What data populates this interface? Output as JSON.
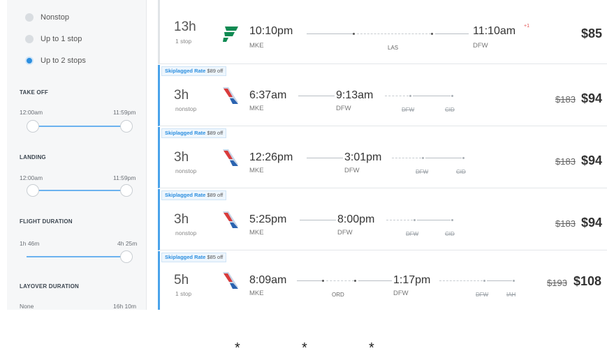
{
  "sidebar": {
    "stops": [
      {
        "label": "Nonstop",
        "selected": false
      },
      {
        "label": "Up to 1 stop",
        "selected": false
      },
      {
        "label": "Up to 2 stops",
        "selected": true
      }
    ],
    "take_off": {
      "title": "TAKE OFF",
      "min": "12:00am",
      "max": "11:59pm"
    },
    "landing": {
      "title": "LANDING",
      "min": "12:00am",
      "max": "11:59pm"
    },
    "flight_duration": {
      "title": "FLIGHT DURATION",
      "min": "1h 46m",
      "max": "4h 25m"
    },
    "layover_duration": {
      "title": "LAYOVER DURATION",
      "min": "None",
      "max": "16h 10m"
    }
  },
  "flights": [
    {
      "duration": "13h",
      "stops": "1 stop",
      "airline": "frontier",
      "depart_time": "10:10pm",
      "depart_airport": "MKE",
      "arrive_time": "11:10am",
      "arrive_plus": "+1",
      "arrive_airport": "DFW",
      "layovers": [
        "LAS"
      ],
      "hidden_layovers": [],
      "old_price": "",
      "price": "$85",
      "badge": null
    },
    {
      "duration": "3h",
      "stops": "nonstop",
      "airline": "american",
      "depart_time": "6:37am",
      "depart_airport": "MKE",
      "arrive_time": "9:13am",
      "arrive_airport": "DFW",
      "layovers": [],
      "hidden_layovers": [
        "DFW",
        "CID"
      ],
      "old_price": "$183",
      "price": "$94",
      "badge": {
        "name": "Skiplagged Rate",
        "off": "$89 off"
      }
    },
    {
      "duration": "3h",
      "stops": "nonstop",
      "airline": "american",
      "depart_time": "12:26pm",
      "depart_airport": "MKE",
      "arrive_time": "3:01pm",
      "arrive_airport": "DFW",
      "layovers": [],
      "hidden_layovers": [
        "DFW",
        "CID"
      ],
      "old_price": "$183",
      "price": "$94",
      "badge": {
        "name": "Skiplagged Rate",
        "off": "$89 off"
      }
    },
    {
      "duration": "3h",
      "stops": "nonstop",
      "airline": "american",
      "depart_time": "5:25pm",
      "depart_airport": "MKE",
      "arrive_time": "8:00pm",
      "arrive_airport": "DFW",
      "layovers": [],
      "hidden_layovers": [
        "DFW",
        "CID"
      ],
      "old_price": "$183",
      "price": "$94",
      "badge": {
        "name": "Skiplagged Rate",
        "off": "$89 off"
      }
    },
    {
      "duration": "5h",
      "stops": "1 stop",
      "airline": "american",
      "depart_time": "8:09am",
      "depart_airport": "MKE",
      "arrive_time": "1:17pm",
      "arrive_airport": "DFW",
      "layovers": [
        "ORD"
      ],
      "hidden_layovers": [
        "DFW",
        "IAH"
      ],
      "old_price": "$193",
      "price": "$108",
      "badge": {
        "name": "Skiplagged Rate",
        "off": "$85 off"
      }
    }
  ],
  "footer": {
    "asterisks": [
      "*",
      "*",
      "*"
    ]
  },
  "colors": {
    "accent": "#2c8fe0",
    "frontier": "#0f8a52",
    "american_red": "#d93b3b",
    "american_blue": "#2a63b0"
  }
}
